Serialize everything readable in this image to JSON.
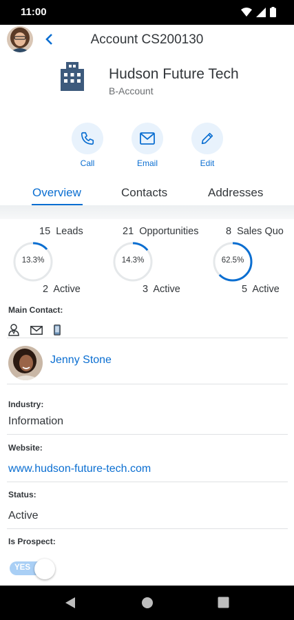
{
  "status_bar": {
    "time": "11:00"
  },
  "header": {
    "title": "Account CS200130"
  },
  "account": {
    "name": "Hudson Future Tech",
    "type": "B-Account"
  },
  "actions": [
    {
      "label": "Call",
      "icon": "phone-icon"
    },
    {
      "label": "Email",
      "icon": "mail-icon"
    },
    {
      "label": "Edit",
      "icon": "pencil-icon"
    }
  ],
  "tabs": [
    {
      "label": "Overview",
      "active": true
    },
    {
      "label": "Contacts",
      "active": false
    },
    {
      "label": "Addresses",
      "active": false
    }
  ],
  "kpis": [
    {
      "count": "15",
      "title": "Leads",
      "percent_label": "13.3%",
      "percent": 13.3,
      "active_count": "2",
      "active_label": "Active"
    },
    {
      "count": "21",
      "title": "Opportunities",
      "percent_label": "14.3%",
      "percent": 14.3,
      "active_count": "3",
      "active_label": "Active"
    },
    {
      "count": "8",
      "title": "Sales Quo",
      "percent_label": "62.5%",
      "percent": 62.5,
      "active_count": "5",
      "active_label": "Active"
    }
  ],
  "main_contact": {
    "label": "Main Contact:",
    "icons": [
      "person-icon",
      "mail-icon",
      "mobile-icon"
    ],
    "name": "Jenny Stone"
  },
  "fields": {
    "industry": {
      "label": "Industry:",
      "value": "Information"
    },
    "website": {
      "label": "Website:",
      "value": "www.hudson-future-tech.com"
    },
    "status": {
      "label": "Status:",
      "value": "Active"
    },
    "prospect": {
      "label": "Is Prospect:",
      "toggle_text": "YES",
      "on": true
    }
  },
  "colors": {
    "accent": "#0a6ed1",
    "ring_track": "#e5e8ea",
    "action_bg": "#e8f2fc"
  }
}
